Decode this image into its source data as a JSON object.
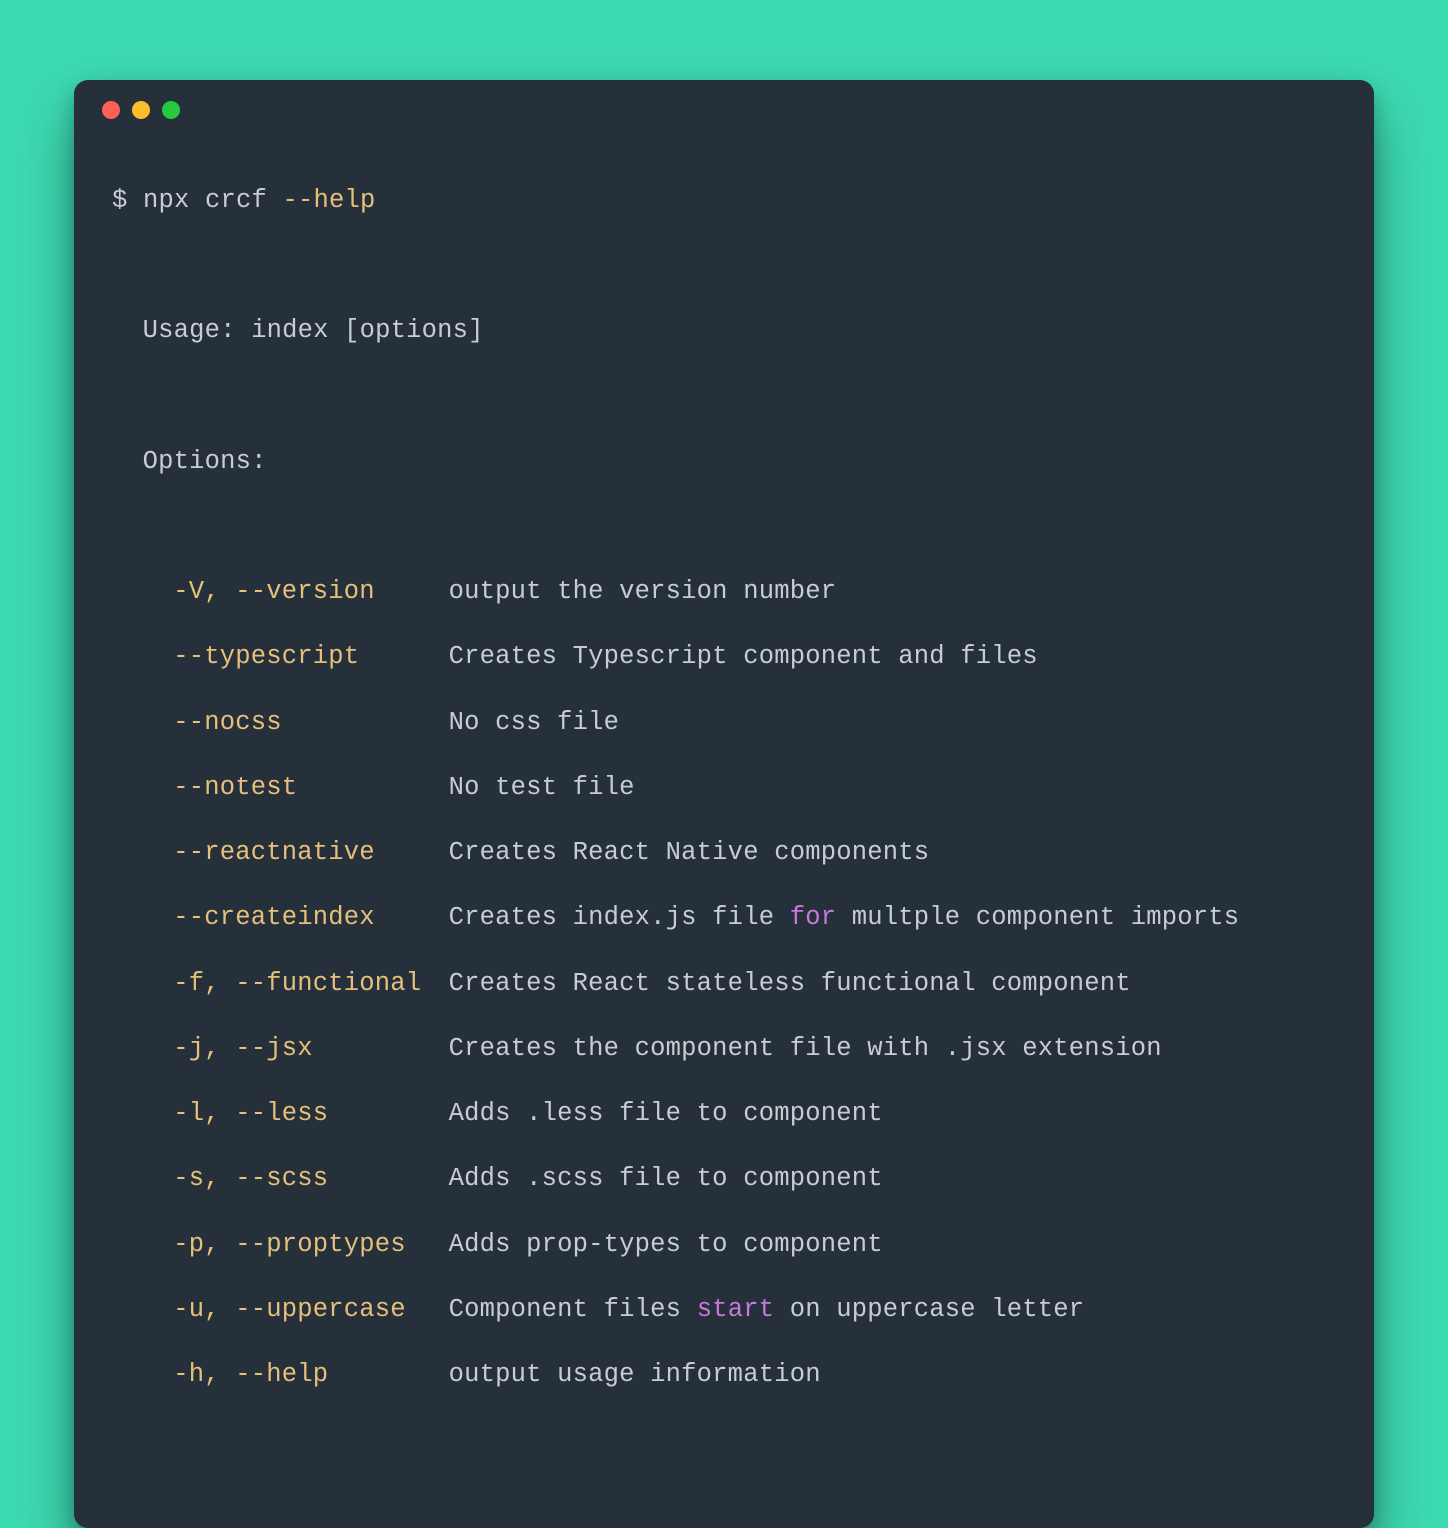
{
  "prompt": "$ ",
  "command": "npx crcf ",
  "command_flag": "--help",
  "usage_line": "Usage: index [options]",
  "options_header": "Options:",
  "options": [
    {
      "flag": "-V, --version",
      "desc_pre": "output the version number",
      "kw": "",
      "desc_post": ""
    },
    {
      "flag": "--typescript",
      "desc_pre": "Creates Typescript component and files",
      "kw": "",
      "desc_post": ""
    },
    {
      "flag": "--nocss",
      "desc_pre": "No css file",
      "kw": "",
      "desc_post": ""
    },
    {
      "flag": "--notest",
      "desc_pre": "No test file",
      "kw": "",
      "desc_post": ""
    },
    {
      "flag": "--reactnative",
      "desc_pre": "Creates React Native components",
      "kw": "",
      "desc_post": ""
    },
    {
      "flag": "--createindex",
      "desc_pre": "Creates index.js file ",
      "kw": "for",
      "desc_post": " multple component imports"
    },
    {
      "flag": "-f, --functional",
      "desc_pre": "Creates React stateless functional component",
      "kw": "",
      "desc_post": ""
    },
    {
      "flag": "-j, --jsx",
      "desc_pre": "Creates the component file with .jsx extension",
      "kw": "",
      "desc_post": ""
    },
    {
      "flag": "-l, --less",
      "desc_pre": "Adds .less file to component",
      "kw": "",
      "desc_post": ""
    },
    {
      "flag": "-s, --scss",
      "desc_pre": "Adds .scss file to component",
      "kw": "",
      "desc_post": ""
    },
    {
      "flag": "-p, --proptypes",
      "desc_pre": "Adds prop-types to component",
      "kw": "",
      "desc_post": ""
    },
    {
      "flag": "-u, --uppercase",
      "desc_pre": "Component files ",
      "kw": "start",
      "desc_post": " on uppercase letter"
    },
    {
      "flag": "-h, --help",
      "desc_pre": "output usage information",
      "kw": "",
      "desc_post": ""
    }
  ]
}
